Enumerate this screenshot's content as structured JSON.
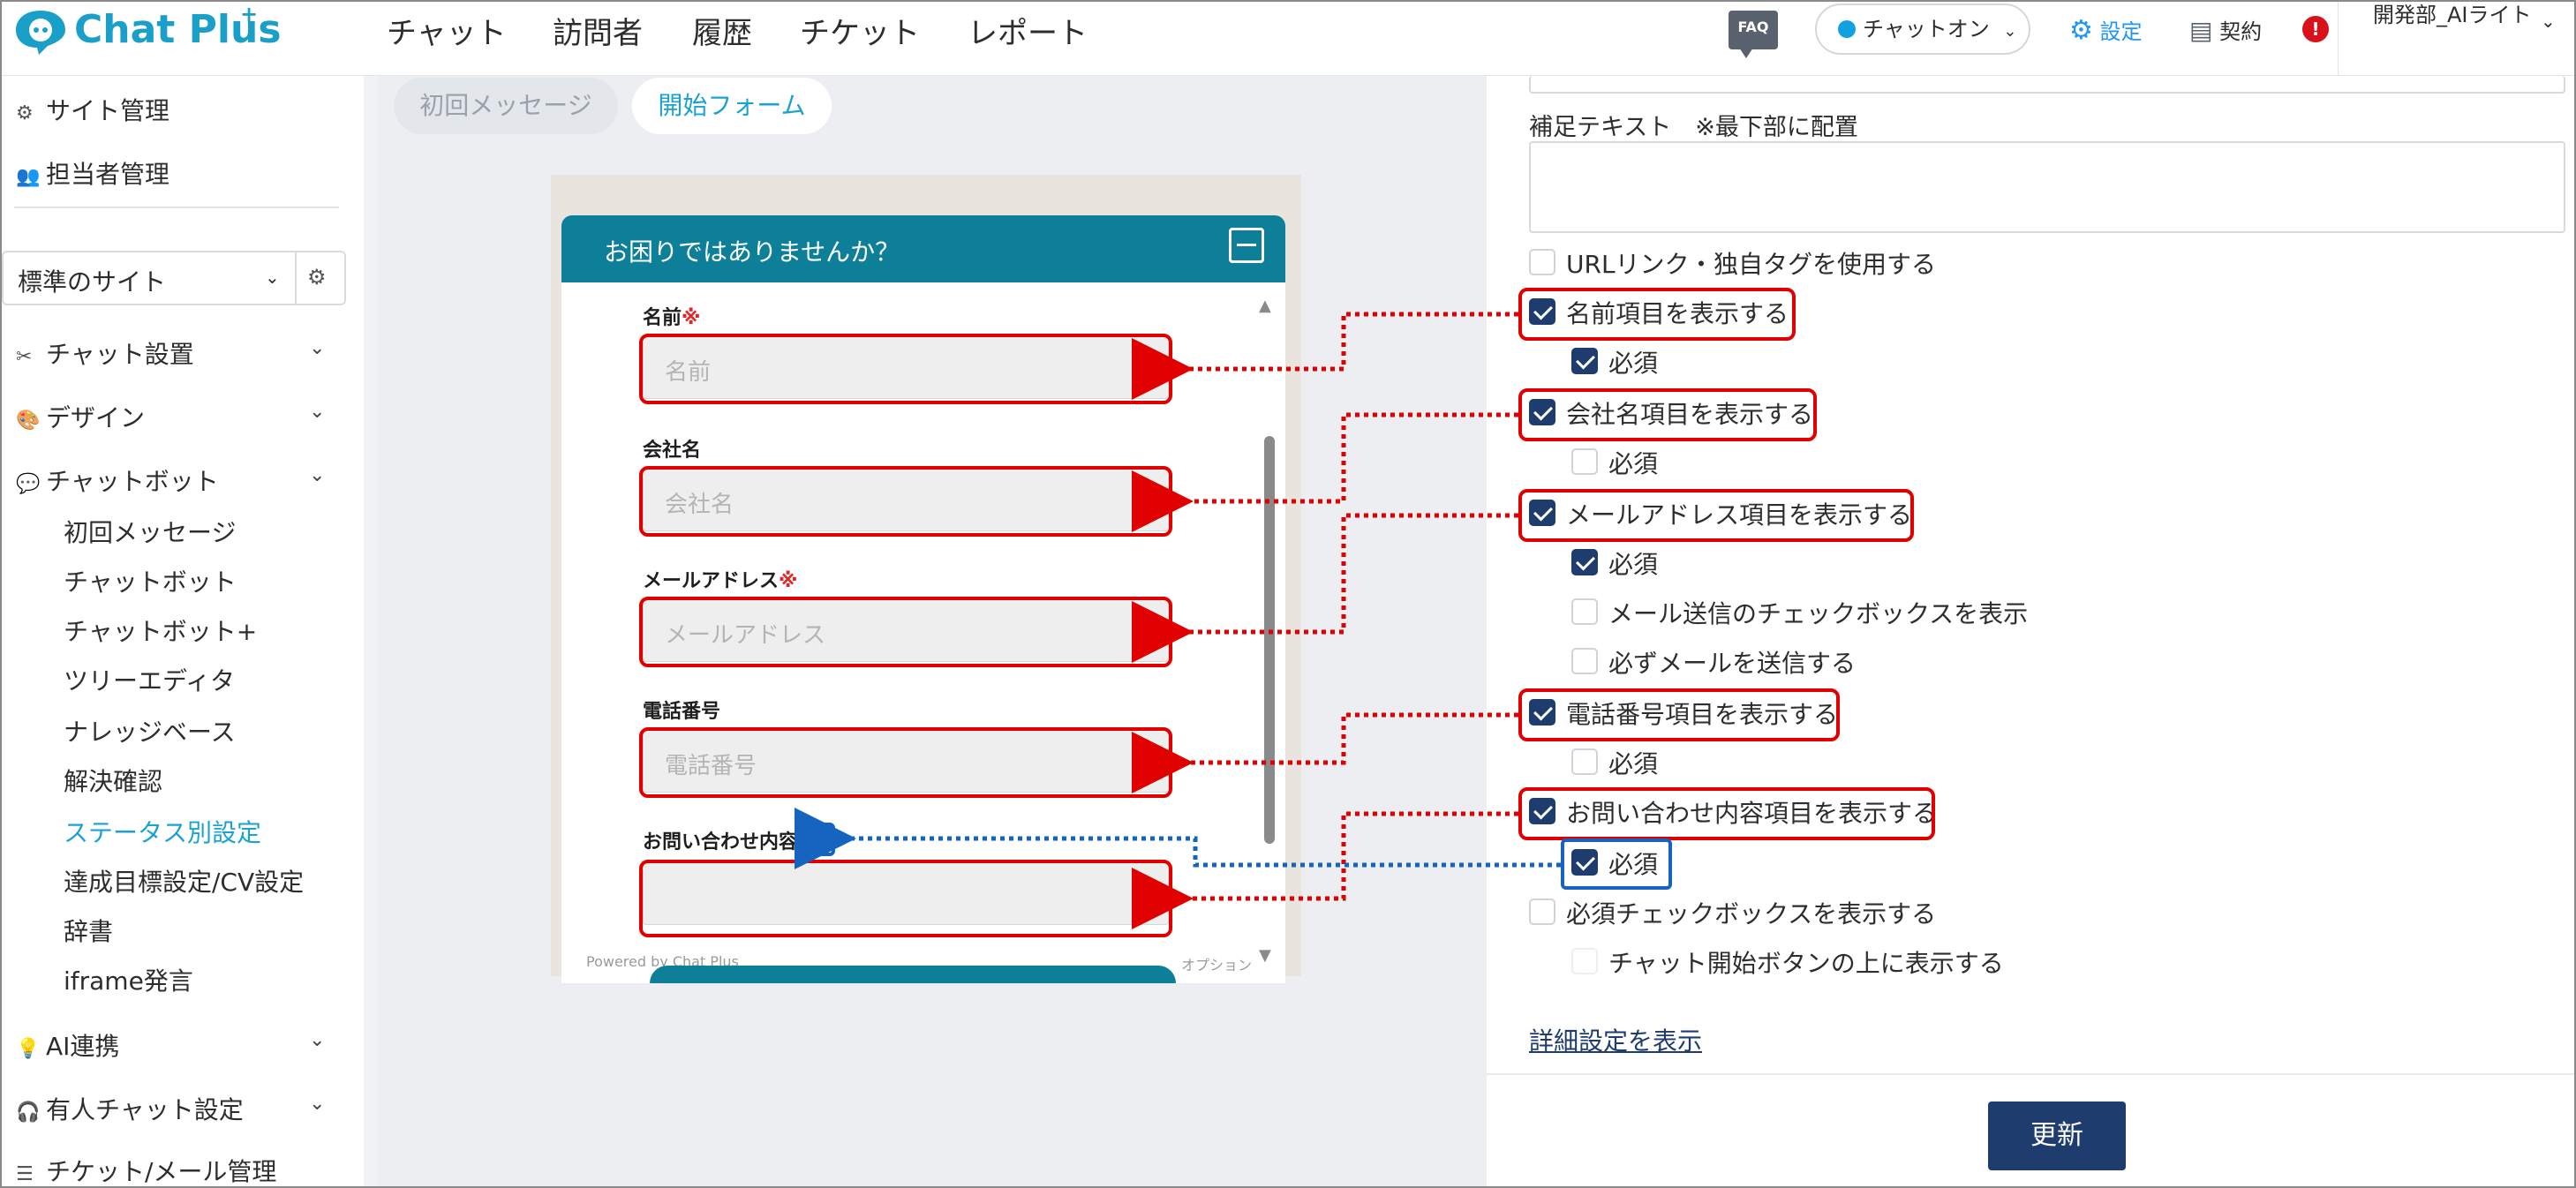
{
  "header": {
    "logo_text": "Chat Plus",
    "logo_sup": "+",
    "nav": [
      "チャット",
      "訪問者",
      "履歴",
      "チケット",
      "レポート"
    ],
    "faq": "FAQ",
    "status": "チャットオン",
    "settings": "設定",
    "contract": "契約",
    "alert": "!",
    "user": "開発部_AIライト"
  },
  "sidebar": {
    "site_manage": "サイト管理",
    "staff_manage": "担当者管理",
    "site_select": "標準のサイト",
    "chat_setup": "チャット設置",
    "design": "デザイン",
    "chatbot": "チャットボット",
    "sub_items": [
      "初回メッセージ",
      "チャットボット",
      "チャットボット+",
      "ツリーエディタ",
      "ナレッジベース",
      "解決確認",
      "ステータス別設定",
      "達成目標設定/CV設定",
      "辞書",
      "iframe発言"
    ],
    "active_sub": "ステータス別設定",
    "ai": "AI連携",
    "manned": "有人チャット設定",
    "ticket": "チケット/メール管理"
  },
  "tabs": {
    "first_message": "初回メッセージ",
    "start_form": "開始フォーム"
  },
  "widget": {
    "title": "お困りではありませんか？",
    "fields": [
      {
        "label": "名前",
        "required": true,
        "placeholder": "名前"
      },
      {
        "label": "会社名",
        "required": false,
        "placeholder": "会社名"
      },
      {
        "label": "メールアドレス",
        "required": true,
        "placeholder": "メールアドレス"
      },
      {
        "label": "電話番号",
        "required": false,
        "placeholder": "電話番号"
      },
      {
        "label": "お問い合わせ内容",
        "required": true,
        "placeholder": ""
      }
    ],
    "req_mark": "※",
    "powered": "Powered by Chat Plus",
    "option": "オプション"
  },
  "panel": {
    "supplement_label": "補足テキスト　※最下部に配置",
    "url_link": "URLリンク・独自タグを使用する",
    "show_name": "名前項目を表示する",
    "required": "必須",
    "show_company": "会社名項目を表示する",
    "show_email": "メールアドレス項目を表示する",
    "show_mail_checkbox": "メール送信のチェックボックスを表示",
    "always_send_mail": "必ずメールを送信する",
    "show_phone": "電話番号項目を表示する",
    "show_inquiry": "お問い合わせ内容項目を表示する",
    "show_required_checkbox": "必須チェックボックスを表示する",
    "above_start_button": "チャット開始ボタンの上に表示する",
    "detail_link": "詳細設定を表示",
    "update": "更新"
  },
  "checkboxes": {
    "url_link": false,
    "show_name": true,
    "name_required": true,
    "show_company": true,
    "company_required": false,
    "show_email": true,
    "email_required": true,
    "mail_checkbox": false,
    "always_send": false,
    "show_phone": true,
    "phone_required": false,
    "show_inquiry": true,
    "inquiry_required": true,
    "show_required_checkbox": false,
    "above_start": false
  },
  "colors": {
    "brand": "#1a9fc9",
    "widget_header": "#0d7f98",
    "highlight_red": "#e00000",
    "highlight_blue": "#1565c0",
    "checkbox_checked": "#1e3c6e"
  }
}
